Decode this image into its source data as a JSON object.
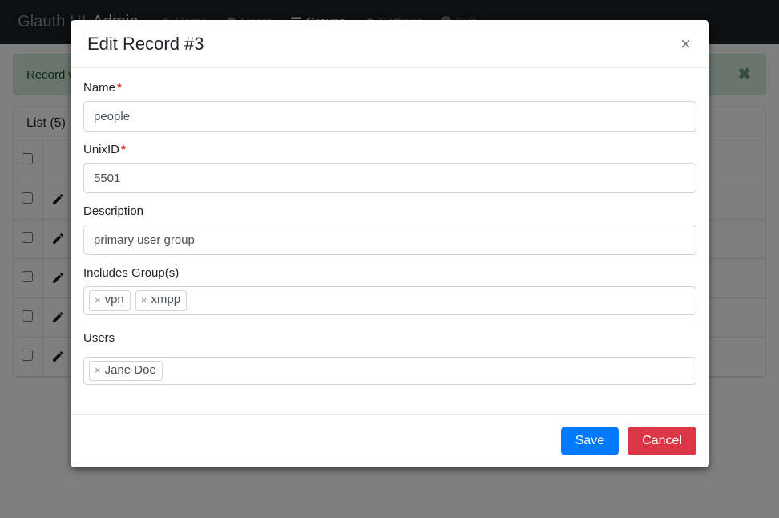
{
  "navbar": {
    "brand": "Glauth UI",
    "brand_suffix": "Admin",
    "items": [
      {
        "label": "Home",
        "icon": "home-icon",
        "active": false
      },
      {
        "label": "Users",
        "icon": "users-icon",
        "active": false
      },
      {
        "label": "Groups",
        "icon": "groups-icon",
        "active": true
      },
      {
        "label": "Settings",
        "icon": "gear-icon",
        "active": false
      },
      {
        "label": "Exit",
        "icon": "power-icon",
        "active": false
      }
    ]
  },
  "alert": {
    "message": "Record was updated",
    "close_label": "✖",
    "bg_color": "#d4edda",
    "text_color": "#155724"
  },
  "list_panel": {
    "title": "List (5)",
    "columns": [
      "",
      "",
      "",
      "",
      ""
    ],
    "rows": [
      {
        "checkbox": "",
        "edit_icon": "pencil-icon"
      },
      {
        "checkbox": "",
        "edit_icon": "pencil-icon"
      },
      {
        "checkbox": "",
        "edit_icon": "pencil-icon"
      },
      {
        "checkbox": "",
        "edit_icon": "pencil-icon"
      },
      {
        "checkbox": "",
        "edit_icon": "pencil-icon"
      }
    ]
  },
  "modal": {
    "title": "Edit Record #3",
    "close_label": "×",
    "fields": {
      "name": {
        "label": "Name",
        "required_mark": "*",
        "value": "people"
      },
      "unixid": {
        "label": "UnixID",
        "required_mark": "*",
        "value": "5501"
      },
      "description": {
        "label": "Description",
        "value": "primary user group"
      },
      "includes_groups": {
        "label": "Includes Group(s)",
        "tags": [
          {
            "remove": "×",
            "text": "vpn"
          },
          {
            "remove": "×",
            "text": "xmpp"
          }
        ]
      },
      "users": {
        "label": "Users",
        "tags": [
          {
            "remove": "×",
            "text": "Jane Doe"
          }
        ]
      }
    },
    "buttons": {
      "save": "Save",
      "cancel": "Cancel",
      "save_color": "#007bff",
      "cancel_color": "#dc3545"
    }
  }
}
